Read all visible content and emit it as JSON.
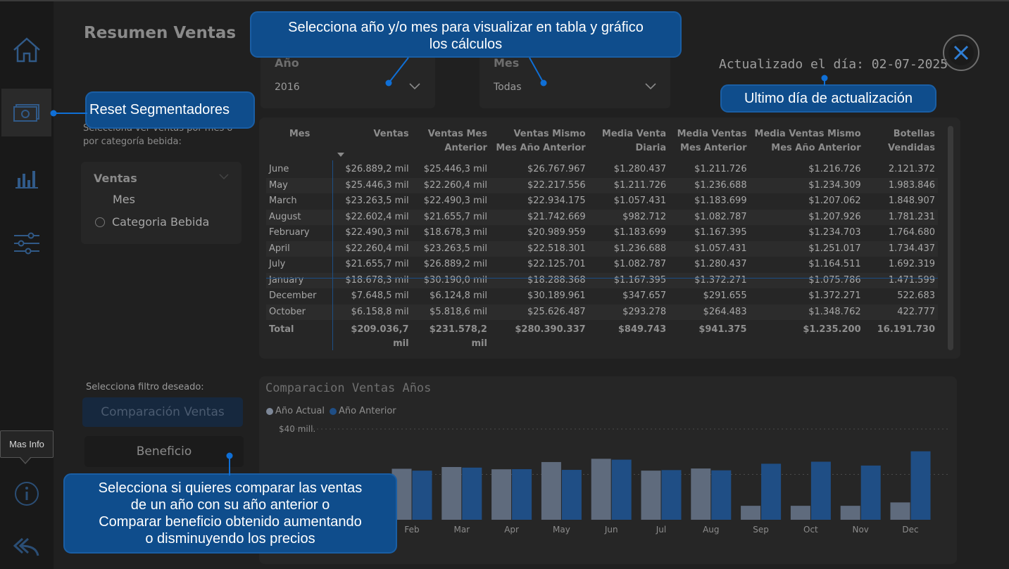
{
  "page_title": "Resumen Ventas",
  "callouts": {
    "select_period": [
      "Selecciona año y/o mes para visualizar en tabla y gráfico",
      "los cálculos"
    ],
    "reset": "Reset Segmentadores",
    "last_update": "Ultimo día de actualización",
    "compare": [
      "Selecciona si quieres comparar las ventas",
      "de un año con su año anterior o",
      "Comparar beneficio obtenido aumentando",
      "o disminuyendo los precios"
    ]
  },
  "filters": {
    "year": {
      "label": "Año",
      "value": "2016"
    },
    "month": {
      "label": "Mes",
      "value": "Todas"
    }
  },
  "updated_text": "Actualizado el día: 02-07-2025",
  "field_slicer": {
    "hint": [
      "Selecciona ver ventas por mes o",
      "por categoría bebida:"
    ],
    "label": "Ventas",
    "options": [
      "Mes",
      "Categoria Bebida"
    ]
  },
  "table": {
    "columns": [
      [
        "Mes"
      ],
      [
        "Ventas"
      ],
      [
        "Ventas Mes",
        "Anterior"
      ],
      [
        "Ventas Mismo",
        "Mes Año Anterior"
      ],
      [
        "Media Venta",
        "Diaria"
      ],
      [
        "Media Ventas",
        "Mes Anterior"
      ],
      [
        "Media Ventas Mismo",
        "Mes Año Anterior"
      ],
      [
        "Botellas",
        "Vendidas"
      ]
    ],
    "rows": [
      [
        "June",
        "$26.889,2 mil",
        "$25.446,3 mil",
        "$26.767.967",
        "$1.280.437",
        "$1.211.726",
        "$1.216.726",
        "2.121.372"
      ],
      [
        "May",
        "$25.446,3 mil",
        "$22.260,4 mil",
        "$22.217.556",
        "$1.211.726",
        "$1.236.688",
        "$1.234.309",
        "1.983.846"
      ],
      [
        "March",
        "$23.263,5 mil",
        "$22.490,3 mil",
        "$22.934.175",
        "$1.057.431",
        "$1.183.699",
        "$1.207.062",
        "1.848.907"
      ],
      [
        "August",
        "$22.602,4 mil",
        "$21.655,7 mil",
        "$21.742.669",
        "$982.712",
        "$1.082.787",
        "$1.207.926",
        "1.781.231"
      ],
      [
        "February",
        "$22.490,3 mil",
        "$18.678,3 mil",
        "$20.989.959",
        "$1.183.699",
        "$1.167.395",
        "$1.234.703",
        "1.764.680"
      ],
      [
        "April",
        "$22.260,4 mil",
        "$23.263,5 mil",
        "$22.518.301",
        "$1.236.688",
        "$1.057.431",
        "$1.251.017",
        "1.734.437"
      ],
      [
        "July",
        "$21.655,7 mil",
        "$26.889,2 mil",
        "$22.125.701",
        "$1.082.787",
        "$1.280.437",
        "$1.164.511",
        "1.692.319"
      ],
      [
        "January",
        "$18.678,3 mil",
        "$30.190,0 mil",
        "$18.288.368",
        "$1.167.395",
        "$1.372.271",
        "$1.075.786",
        "1.471.599"
      ],
      [
        "December",
        "$7.648,5 mil",
        "$6.124,8 mil",
        "$30.189.961",
        "$347.657",
        "$291.655",
        "$1.372.271",
        "522.683"
      ],
      [
        "October",
        "$6.158,8 mil",
        "$5.818,6 mil",
        "$25.626.487",
        "$293.278",
        "$264.483",
        "$1.348.762",
        "422.777"
      ]
    ],
    "total": [
      "Total",
      "$209.036,7 mil",
      "$231.578,2 mil",
      "$280.390.337",
      "$849.743",
      "$941.375",
      "$1.235.200",
      "16.191.730"
    ]
  },
  "filter_hint": "Selecciona filtro deseado:",
  "buttons": {
    "comparison": "Comparación Ventas",
    "profit": "Beneficio"
  },
  "tooltip": "Mas Info",
  "colors": {
    "current_year": "#5f6b7d",
    "previous_year": "#1f4e85",
    "callout": "#0f4d8c"
  },
  "chart_data": {
    "type": "bar",
    "title": "Comparacion Ventas Años",
    "legend_position": "top-left",
    "y_tick_label": "$40 mill.",
    "categories": [
      "Feb",
      "Mar",
      "Apr",
      "May",
      "Jun",
      "Jul",
      "Aug",
      "Sep",
      "Oct",
      "Nov",
      "Dec"
    ],
    "series": [
      {
        "name": "Año Actual",
        "values": [
          22.49,
          23.26,
          22.26,
          25.45,
          26.89,
          21.66,
          22.6,
          6.16,
          6.16,
          6.16,
          7.65
        ]
      },
      {
        "name": "Año Anterior",
        "values": [
          21.66,
          23.0,
          22.3,
          22.0,
          26.5,
          21.9,
          21.8,
          24.7,
          25.6,
          23.9,
          30.19
        ]
      }
    ],
    "ylim": [
      0,
      40
    ],
    "grid": true
  }
}
